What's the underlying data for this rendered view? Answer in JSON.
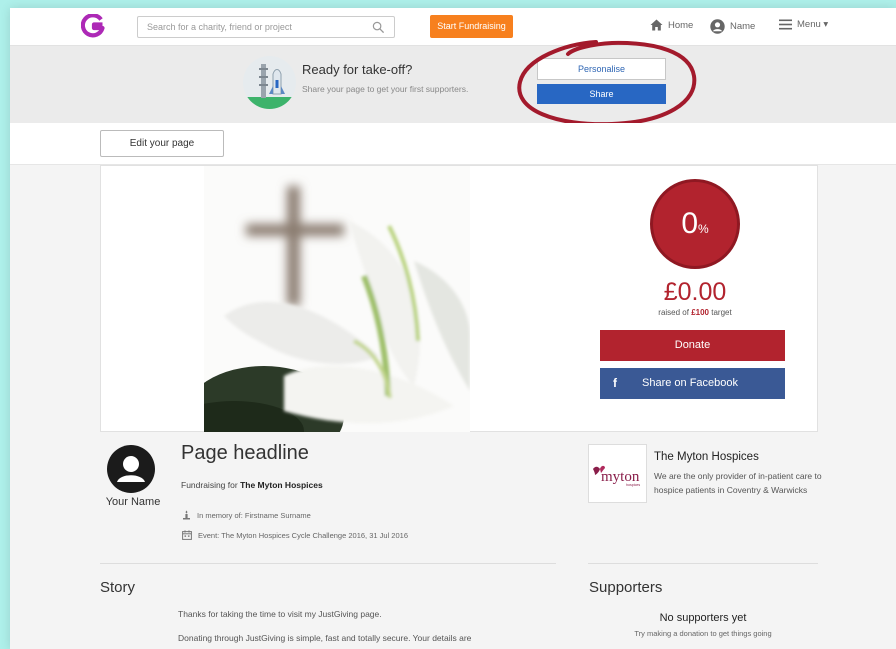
{
  "nav": {
    "search_placeholder": "Search for a charity, friend or project",
    "start_fundraising": "Start Fundraising",
    "home": "Home",
    "name": "Name",
    "menu": "Menu ▾"
  },
  "banner": {
    "title": "Ready for take-off?",
    "subtitle": "Share your page to get your first supporters.",
    "personalise": "Personalise",
    "share": "Share"
  },
  "edit_page": "Edit your page",
  "progress": {
    "percent_value": "0",
    "percent_sign": "%",
    "amount": "£0.00",
    "raised_prefix": "raised of",
    "target": "£100",
    "raised_suffix": "target",
    "donate": "Donate",
    "fb_share": "Share on Facebook",
    "fb_icon": "f"
  },
  "profile": {
    "name": "Your Name",
    "headline": "Page headline",
    "fundraising_prefix": "Fundraising for",
    "charity": "The Myton Hospices",
    "memory": "In memory of: Firstname Surname",
    "event": "Event: The Myton Hospices Cycle Challenge 2016, 31 Jul 2016"
  },
  "charity": {
    "name": "The Myton Hospices",
    "description": "We are the only provider of in-patient care to hospice patients in Coventry & Warwicks",
    "logo_text": "myton",
    "logo_sub": "hospices"
  },
  "story": {
    "heading": "Story",
    "p1": "Thanks for taking the time to visit my JustGiving page.",
    "p2": "Donating through JustGiving is simple, fast and totally secure. Your details are"
  },
  "supporters": {
    "heading": "Supporters",
    "empty_title": "No supporters yet",
    "empty_sub": "Try making a donation to get things going"
  },
  "colors": {
    "brand_purple": "#ad29b6",
    "start_orange": "#f7801e",
    "share_blue": "#2867c3",
    "crimson": "#b2232e",
    "facebook": "#3a5995",
    "annotation": "#a31a2c"
  }
}
